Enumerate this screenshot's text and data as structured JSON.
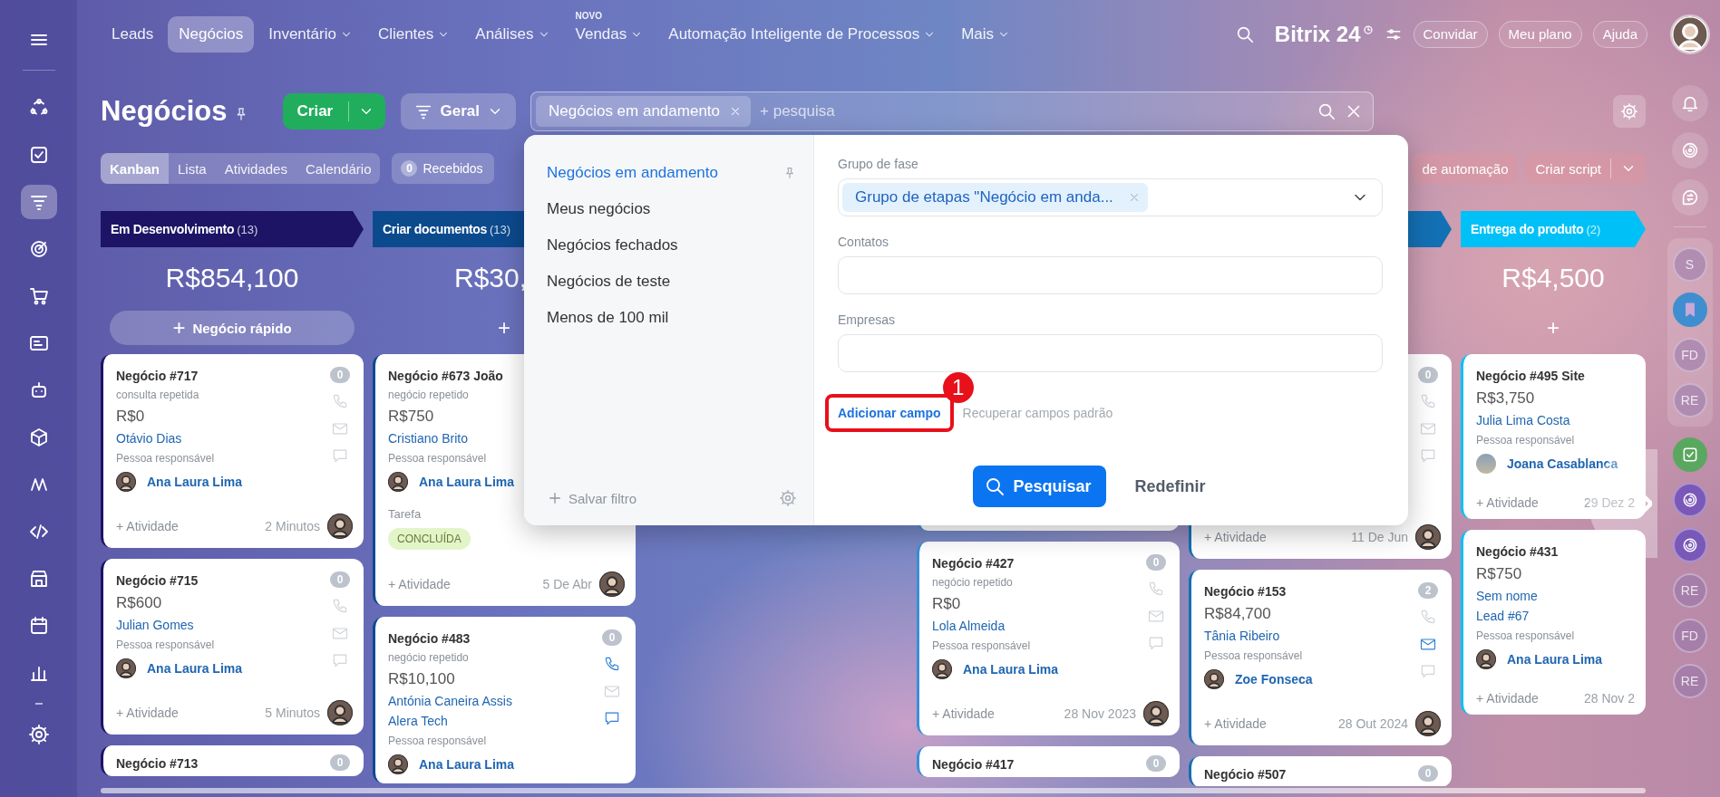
{
  "nav": {
    "items": [
      {
        "label": "Leads",
        "selected": false,
        "dropdown": false
      },
      {
        "label": "Negócios",
        "selected": true,
        "dropdown": false
      },
      {
        "label": "Inventário",
        "selected": false,
        "dropdown": true
      },
      {
        "label": "Clientes",
        "selected": false,
        "dropdown": true
      },
      {
        "label": "Análises",
        "selected": false,
        "dropdown": true
      },
      {
        "label": "Vendas",
        "selected": false,
        "dropdown": true,
        "badge": "NOVO"
      },
      {
        "label": "Automação Inteligente de Processos",
        "selected": false,
        "dropdown": true
      },
      {
        "label": "Mais",
        "selected": false,
        "dropdown": true
      }
    ],
    "logo": {
      "text": "Bitrix",
      "number": "24"
    },
    "buttons": [
      "Convidar",
      "Meu plano",
      "Ajuda"
    ]
  },
  "left_rail": {
    "items": [
      {
        "selected": false
      },
      {
        "selected": false
      },
      {
        "selected": true
      },
      {
        "selected": false
      },
      {
        "selected": false
      },
      {
        "selected": false
      },
      {
        "selected": false
      },
      {
        "selected": false
      },
      {
        "selected": false
      },
      {
        "selected": false
      },
      {
        "selected": false
      },
      {
        "selected": false
      },
      {
        "selected": false
      }
    ]
  },
  "page": {
    "title": "Negócios",
    "create_button": "Criar",
    "view_button": "Geral",
    "search": {
      "tag": "Negócios em andamento",
      "placeholder": "+ pesquisa"
    }
  },
  "view_tabs": [
    {
      "label": "Kanban",
      "selected": true
    },
    {
      "label": "Lista",
      "selected": false
    },
    {
      "label": "Atividades",
      "selected": false
    },
    {
      "label": "Calendário",
      "selected": false
    }
  ],
  "incoming": {
    "count": "0",
    "label": "Recebidos"
  },
  "automation_button": "de automação",
  "script_button": "Criar script",
  "columns": [
    {
      "title": "Em Desenvolvimento",
      "count": "(13)",
      "color": "#1d1466",
      "sum": "R$854,100",
      "add_icon": "+",
      "add_label": "Negócio rápido",
      "cards": [
        {
          "kind": "full",
          "title": "Negócio #717",
          "subtitle": "consulta repetida",
          "amount": "R$0",
          "contacts": [
            "Otávio Dias"
          ],
          "responsible_label": "Pessoa responsável",
          "responsible": "Ana Laura Lima",
          "responsible_photo": false,
          "badge": "0",
          "icons": {
            "phone": false,
            "mail": false,
            "chat": false
          },
          "footer_action": "+ Atividade",
          "footer_time": "2 Minutos",
          "footer_avatar": true
        },
        {
          "kind": "full",
          "title": "Negócio #715",
          "amount": "R$600",
          "contacts": [
            "Julian Gomes"
          ],
          "responsible_label": "Pessoa responsável",
          "responsible": "Ana Laura Lima",
          "responsible_photo": false,
          "badge": "0",
          "icons": {
            "phone": false,
            "mail": false,
            "chat": false
          },
          "footer_action": "+ Atividade",
          "footer_time": "5 Minutos",
          "footer_avatar": true
        },
        {
          "kind": "stub",
          "title": "Negócio #713",
          "badge": "0"
        }
      ]
    },
    {
      "title": "Criar documentos",
      "count": "(13)",
      "color": "#0c4a8e",
      "sum": "R$30,",
      "add_icon": "+",
      "cards": [
        {
          "kind": "full",
          "title": "Negócio #673 João",
          "subtitle": "negócio repetido",
          "amount": "R$750",
          "contacts": [
            "Cristiano Brito"
          ],
          "responsible_label": "Pessoa responsável",
          "responsible": "Ana Laura Lima",
          "responsible_photo": false,
          "task_label": "Tarefa",
          "task_status": "CONCLUÍDA",
          "footer_action": "+ Atividade",
          "footer_time": "5 De Abr",
          "footer_avatar": true
        },
        {
          "kind": "full",
          "title": "Negócio #483",
          "subtitle": "negócio repetido",
          "amount": "R$10,100",
          "contacts": [
            "Antónia Caneira Assis",
            "Alera Tech"
          ],
          "responsible_label": "Pessoa responsável",
          "responsible": "Ana Laura Lima",
          "responsible_photo": false,
          "badge": "0",
          "icons": {
            "phone": true,
            "mail": false,
            "chat": true
          }
        }
      ]
    },
    {},
    {
      "cards": [
        {
          "kind": "partial"
        },
        {
          "kind": "full",
          "title": "Negócio #427",
          "subtitle": "negócio repetido",
          "amount": "R$0",
          "contacts": [
            "Lola Almeida"
          ],
          "responsible_label": "Pessoa responsável",
          "responsible": "Ana Laura Lima",
          "responsible_photo": false,
          "badge": "0",
          "icons": {
            "phone": false,
            "mail": false,
            "chat": false
          },
          "footer_action": "+ Atividade",
          "footer_time": "28 Nov 2023",
          "footer_avatar": true
        },
        {
          "kind": "stub",
          "title": "Negócio #417",
          "badge": "0"
        }
      ]
    },
    {
      "color": "#1470b4",
      "cards": [
        {
          "kind": "partial",
          "badge": "0",
          "icons": {
            "phone": false,
            "mail": false,
            "chat": false
          },
          "footer_action": "+ Atividade",
          "footer_time": "11 De Jun",
          "footer_avatar": true
        },
        {
          "kind": "full",
          "title": "Negócio #153",
          "amount": "R$84,700",
          "contacts": [
            "Tânia Ribeiro"
          ],
          "responsible_label": "Pessoa responsável",
          "responsible": "Zoe Fonseca",
          "responsible_photo": false,
          "badge": "2",
          "icons": {
            "phone": false,
            "mail": true,
            "chat": false
          },
          "footer_action": "+ Atividade",
          "footer_time": "28 Out 2024",
          "footer_avatar": true
        },
        {
          "kind": "stub",
          "title": "Negócio #507",
          "badge": "0"
        }
      ]
    },
    {
      "title": "Entrega do produto",
      "count": "(2)",
      "color": "#00c1f7",
      "sum": "R$4,500",
      "add_icon": "+",
      "cards": [
        {
          "kind": "full",
          "title": "Negócio #495 Site",
          "amount": "R$3,750",
          "contacts": [
            "Julia Lima Costa"
          ],
          "responsible_label": "Pessoa responsável",
          "responsible": "Joana Casablanca",
          "responsible_photo": true,
          "footer_action": "+ Atividade",
          "footer_time": "29 Dez 2",
          "footer_avatar": false
        },
        {
          "kind": "full",
          "title": "Negócio #431",
          "amount": "R$750",
          "contacts": [
            "Sem nome",
            "Lead #67"
          ],
          "responsible_label": "Pessoa responsável",
          "responsible": "Ana Laura Lima",
          "responsible_photo": false,
          "footer_action": "+ Atividade",
          "footer_time": "28 Nov 2",
          "footer_avatar": false
        }
      ]
    }
  ],
  "filter_popup": {
    "presets": [
      {
        "label": "Negócios em andamento",
        "selected": true,
        "pinned": true
      },
      {
        "label": "Meus negócios",
        "selected": false,
        "pinned": false
      },
      {
        "label": "Negócios fechados",
        "selected": false,
        "pinned": false
      },
      {
        "label": "Negócios de teste",
        "selected": false,
        "pinned": false
      },
      {
        "label": "Menos de 100 mil",
        "selected": false,
        "pinned": false
      }
    ],
    "save_label": "Salvar filtro",
    "fields": [
      {
        "label": "Grupo de fase",
        "kind": "select",
        "tag": "Grupo de etapas \"Negócio em anda..."
      },
      {
        "label": "Contatos",
        "kind": "text"
      },
      {
        "label": "Empresas",
        "kind": "text"
      }
    ],
    "add_field": "Adicionar campo",
    "restore_fields": "Recuperar campos padrão",
    "annotation": "1",
    "search_button": "Pesquisar",
    "reset_button": "Redefinir"
  },
  "right_rail": {
    "pinned_chats": [
      {
        "kind": "initials",
        "text": "S"
      },
      {
        "kind": "bookmark"
      },
      {
        "kind": "initials",
        "text": "FD"
      },
      {
        "kind": "initials",
        "text": "RE"
      }
    ],
    "chats": [
      {
        "kind": "check"
      },
      {
        "kind": "swirl"
      },
      {
        "kind": "swirl"
      },
      {
        "kind": "initials",
        "text": "RE"
      },
      {
        "kind": "initials",
        "text": "FD"
      },
      {
        "kind": "initials",
        "text": "RE"
      }
    ]
  }
}
